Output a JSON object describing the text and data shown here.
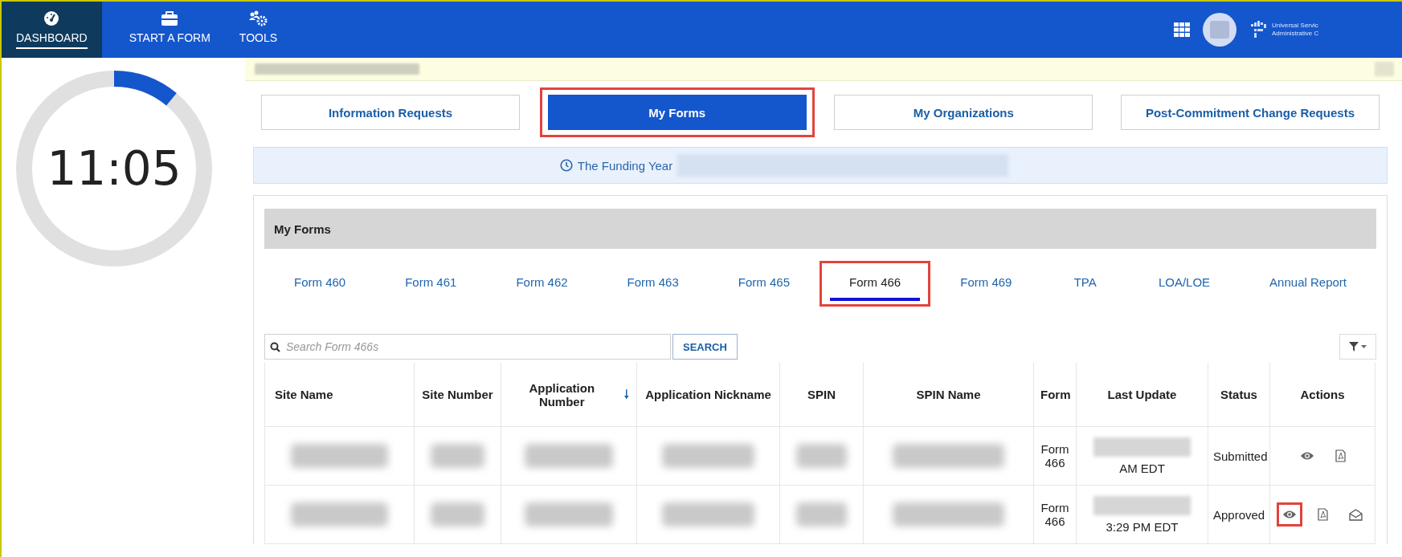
{
  "nav": {
    "items": [
      {
        "label": "DASHBOARD",
        "kind": "gauge",
        "selected": true
      },
      {
        "label": "START A FORM",
        "kind": "briefcase",
        "selected": false
      },
      {
        "label": "TOOLS",
        "kind": "tools",
        "selected": false
      }
    ],
    "logo": [
      "Universal Servic",
      "Administrative C"
    ]
  },
  "timer": {
    "time": "11:05",
    "level": 0.11
  },
  "section_tabs": [
    {
      "label": "Information Requests",
      "selected": false,
      "highlighted": false
    },
    {
      "label": "My Forms",
      "selected": true,
      "highlighted": true
    },
    {
      "label": "My Organizations",
      "selected": false,
      "highlighted": false
    },
    {
      "label": "Post-Commitment Change Requests",
      "selected": false,
      "highlighted": false
    }
  ],
  "funding_banner": {
    "text": "The Funding Year"
  },
  "panel": {
    "title": "My Forms",
    "form_tabs": [
      {
        "label": "Form 460",
        "selected": false,
        "highlighted": false
      },
      {
        "label": "Form 461",
        "selected": false,
        "highlighted": false
      },
      {
        "label": "Form 462",
        "selected": false,
        "highlighted": false
      },
      {
        "label": "Form 463",
        "selected": false,
        "highlighted": false
      },
      {
        "label": "Form 465",
        "selected": false,
        "highlighted": false
      },
      {
        "label": "Form 466",
        "selected": true,
        "highlighted": true
      },
      {
        "label": "Form 469",
        "selected": false,
        "highlighted": false
      },
      {
        "label": "TPA",
        "selected": false,
        "highlighted": false
      },
      {
        "label": "LOA/LOE",
        "selected": false,
        "highlighted": false
      },
      {
        "label": "Annual Report",
        "selected": false,
        "highlighted": false
      }
    ],
    "search": {
      "placeholder": "Search Form 466s",
      "button": "SEARCH"
    },
    "table": {
      "columns": [
        {
          "label": "Site Name",
          "sorted": false
        },
        {
          "label": "Site Number",
          "sorted": false
        },
        {
          "label": "Application Number",
          "sorted": true
        },
        {
          "label": "Application Nickname",
          "sorted": false
        },
        {
          "label": "SPIN",
          "sorted": false
        },
        {
          "label": "SPIN Name",
          "sorted": false
        },
        {
          "label": "Form",
          "sorted": false
        },
        {
          "label": "Last Update",
          "sorted": false
        },
        {
          "label": "Status",
          "sorted": false
        },
        {
          "label": "Actions",
          "sorted": false
        }
      ],
      "rows": [
        {
          "cells": [
            {
              "kind": "blur"
            },
            {
              "kind": "blur"
            },
            {
              "kind": "blur"
            },
            {
              "kind": "blur"
            },
            {
              "kind": "blur"
            },
            {
              "kind": "blur"
            },
            {
              "kind": "text",
              "text": "Form 466"
            },
            {
              "kind": "blur_text",
              "text": "AM EDT"
            },
            {
              "kind": "text",
              "text": "Submitted"
            },
            {
              "kind": "actions",
              "actions": [
                {
                  "kind": "view",
                  "highlighted": false
                },
                {
                  "kind": "pdf",
                  "highlighted": false
                }
              ]
            }
          ]
        },
        {
          "cells": [
            {
              "kind": "blur"
            },
            {
              "kind": "blur"
            },
            {
              "kind": "blur"
            },
            {
              "kind": "blur"
            },
            {
              "kind": "blur"
            },
            {
              "kind": "blur"
            },
            {
              "kind": "text",
              "text": "Form 466"
            },
            {
              "kind": "blur_text",
              "text": "3:29 PM EDT"
            },
            {
              "kind": "text",
              "text": "Approved"
            },
            {
              "kind": "actions",
              "actions": [
                {
                  "kind": "view",
                  "highlighted": true
                },
                {
                  "kind": "pdf",
                  "highlighted": false
                },
                {
                  "kind": "mail",
                  "highlighted": false
                }
              ]
            }
          ]
        }
      ]
    }
  }
}
